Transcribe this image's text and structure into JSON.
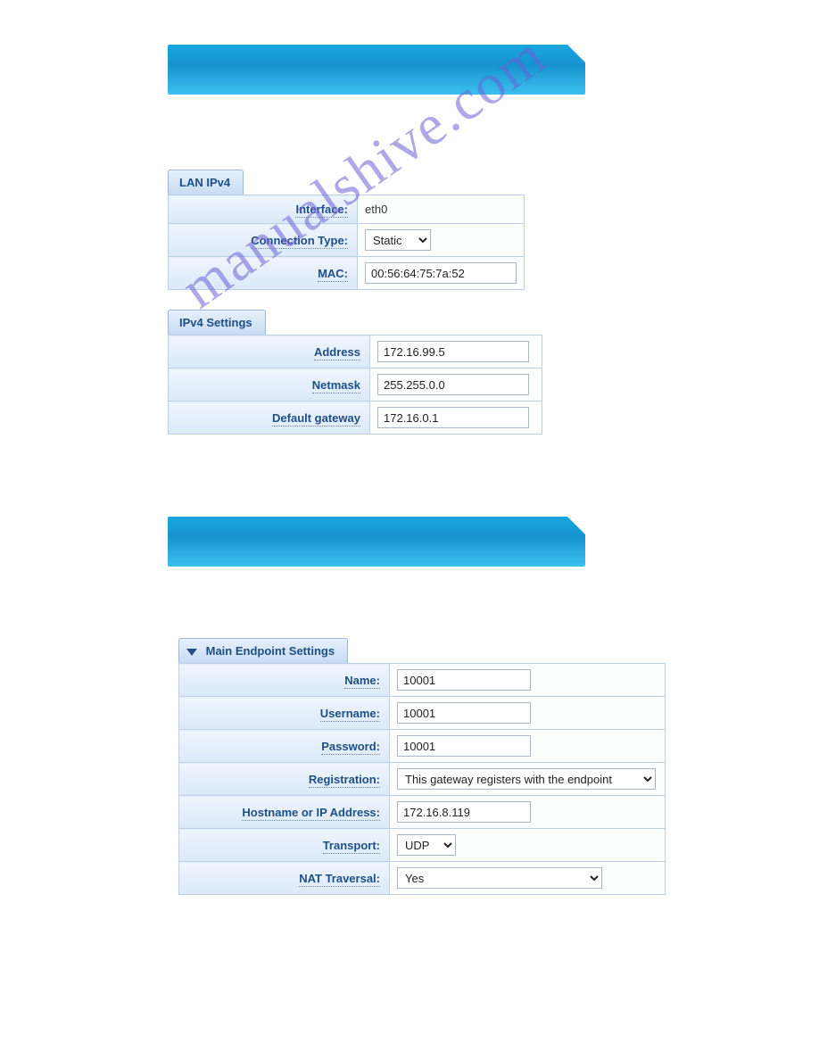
{
  "watermark": "manualshive.com",
  "lan": {
    "tab": "LAN IPv4",
    "interface_label": "Interface:",
    "interface_value": "eth0",
    "conn_label": "Connection Type:",
    "conn_value": "Static",
    "mac_label": "MAC:",
    "mac_value": "00:56:64:75:7a:52"
  },
  "ipv4": {
    "tab": "IPv4 Settings",
    "address_label": "Address",
    "address_value": "172.16.99.5",
    "netmask_label": "Netmask",
    "netmask_value": "255.255.0.0",
    "gateway_label": "Default gateway",
    "gateway_value": "172.16.0.1"
  },
  "endpoint": {
    "tab": "Main Endpoint Settings",
    "name_label": "Name:",
    "name_value": "10001",
    "user_label": "Username:",
    "user_value": "10001",
    "pass_label": "Password:",
    "pass_value": "10001",
    "reg_label": "Registration:",
    "reg_value": "This gateway registers with the endpoint",
    "host_label": "Hostname or IP Address:",
    "host_value": "172.16.8.119",
    "transport_label": "Transport:",
    "transport_value": "UDP",
    "nat_label": "NAT Traversal:",
    "nat_value": "Yes"
  }
}
